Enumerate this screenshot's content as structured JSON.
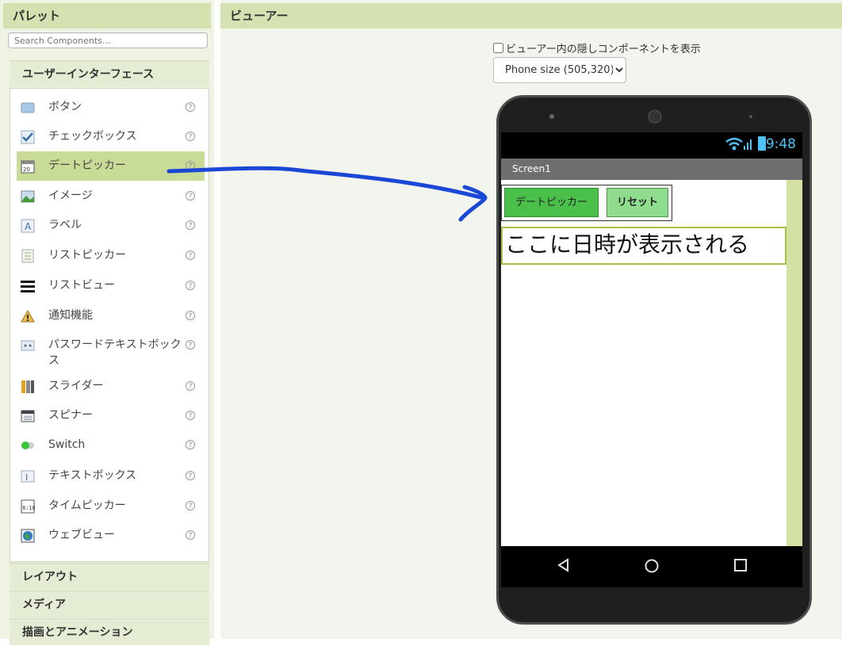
{
  "palette": {
    "title": "パレット",
    "search_placeholder": "Search Components...",
    "category_ui": "ユーザーインターフェース",
    "items": [
      {
        "label": "ボタン"
      },
      {
        "label": "チェックボックス"
      },
      {
        "label": "デートピッカー"
      },
      {
        "label": "イメージ"
      },
      {
        "label": "ラベル"
      },
      {
        "label": "リストピッカー"
      },
      {
        "label": "リストビュー"
      },
      {
        "label": "通知機能"
      },
      {
        "label": "パスワードテキストボックス"
      },
      {
        "label": "スライダー"
      },
      {
        "label": "スピナー"
      },
      {
        "label": "Switch"
      },
      {
        "label": "テキストボックス"
      },
      {
        "label": "タイムピッカー"
      },
      {
        "label": "ウェブビュー"
      }
    ],
    "help_glyph": "?",
    "categories_bottom": [
      "レイアウト",
      "メディア",
      "描画とアニメーション"
    ]
  },
  "viewer": {
    "title": "ビューアー",
    "hidden_checkbox_label": "ビューアー内の隠しコンポーネントを表示",
    "phone_size_selected": "Phone size (505,320)"
  },
  "phone": {
    "time": "9:48",
    "screen_title": "Screen1",
    "date_button": "デートピッカー",
    "reset_button": "リセット",
    "label_text": "ここに日時が表示される"
  },
  "colors": {
    "header": "#d3e2b0",
    "selected_item": "#c8dc97",
    "arrow": "#1a47d6",
    "date_button": "#4ac04a",
    "reset_button": "#8fdc8f"
  }
}
